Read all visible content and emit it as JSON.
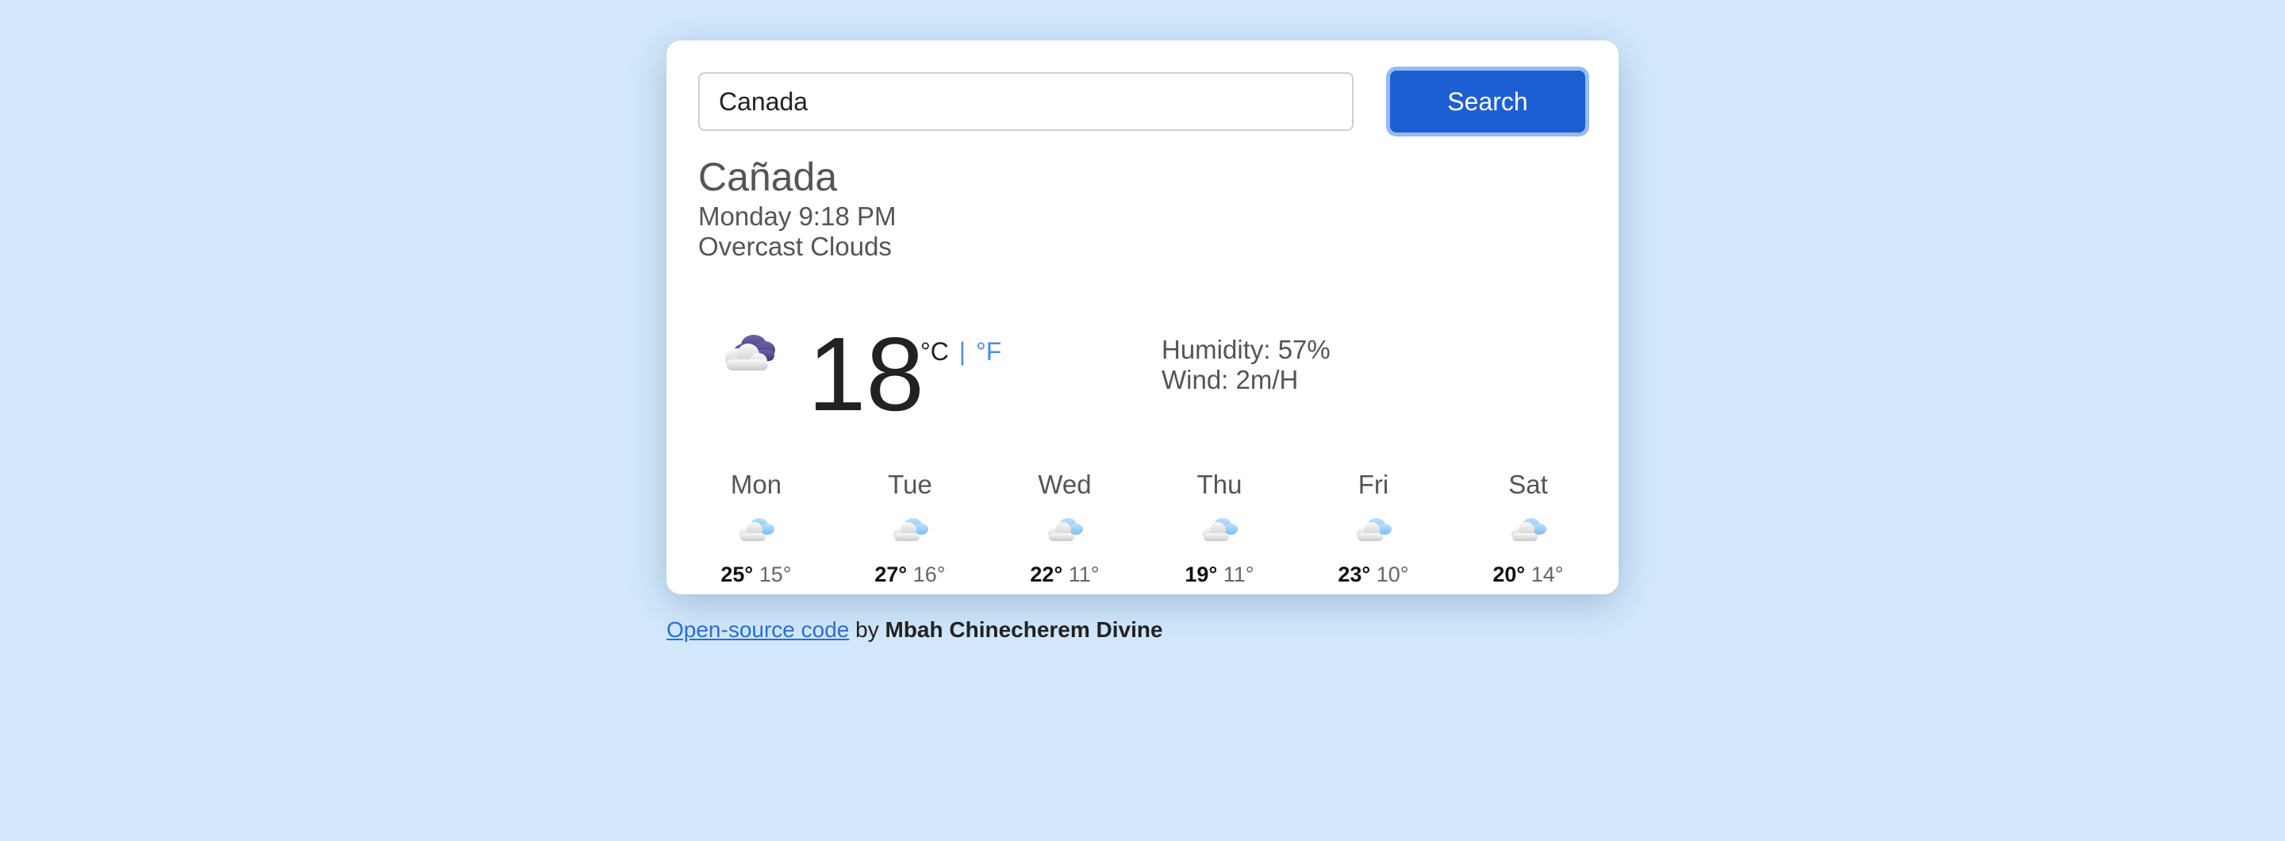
{
  "search": {
    "value": "Canada",
    "button_label": "Search"
  },
  "current": {
    "location": "Cañada",
    "datetime": "Monday 9:18 PM",
    "condition": "Overcast Clouds",
    "icon": "overcast-clouds-night-icon",
    "temperature": "18",
    "unit_c": "°C",
    "unit_sep": "|",
    "unit_f": "°F",
    "humidity": "Humidity: 57%",
    "wind": "Wind: 2m/H"
  },
  "forecast": [
    {
      "day": "Mon",
      "high": "25°",
      "low": "15°",
      "icon": "rain-cloud-icon"
    },
    {
      "day": "Tue",
      "high": "27°",
      "low": "16°",
      "icon": "rain-cloud-icon"
    },
    {
      "day": "Wed",
      "high": "22°",
      "low": "11°",
      "icon": "rain-cloud-icon"
    },
    {
      "day": "Thu",
      "high": "19°",
      "low": "11°",
      "icon": "rain-cloud-icon"
    },
    {
      "day": "Fri",
      "high": "23°",
      "low": "10°",
      "icon": "rain-cloud-icon"
    },
    {
      "day": "Sat",
      "high": "20°",
      "low": "14°",
      "icon": "rain-cloud-icon"
    }
  ],
  "footer": {
    "link_text": "Open-source code",
    "by_text": "by",
    "author": "Mbah Chinecherem Divine"
  },
  "colors": {
    "background": "#d3e8fc",
    "accent": "#1d5fd3",
    "link": "#2a6edb"
  }
}
